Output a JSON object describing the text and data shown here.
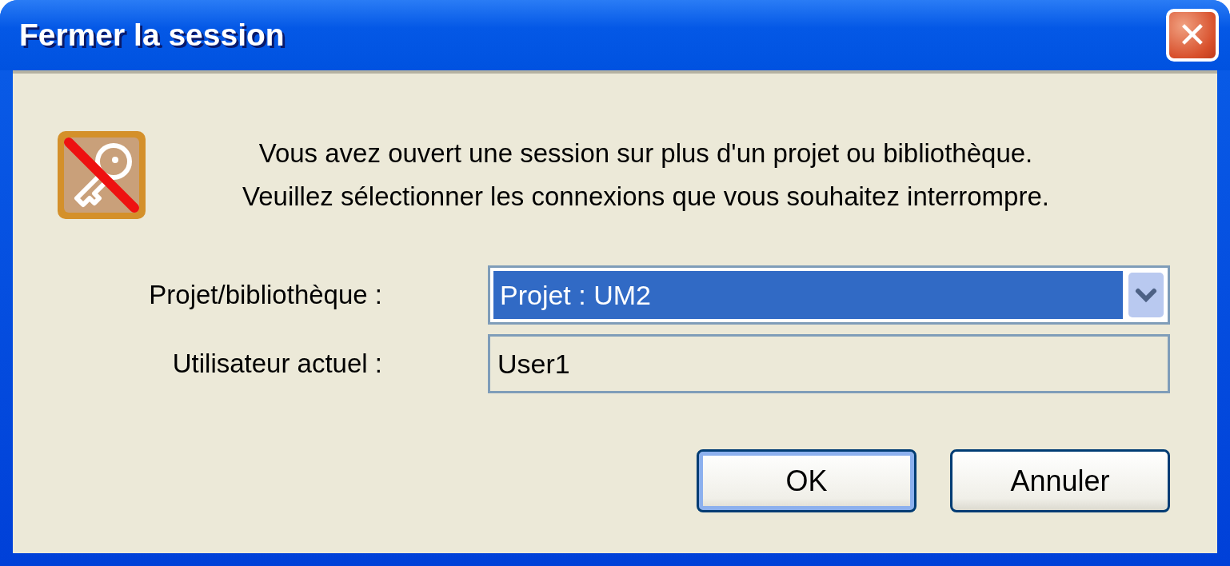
{
  "window": {
    "title": "Fermer la session",
    "close_label": "✕"
  },
  "message": [
    "Vous avez ouvert une session sur plus d'un projet ou bibliothèque.",
    "Veuillez sélectionner les connexions que vous souhaitez interrompre."
  ],
  "fields": [
    {
      "label": "Projet/bibliothèque :",
      "kind": "dropdown",
      "value": "Projet : UM2",
      "highlighted": true
    },
    {
      "label": "Utilisateur actuel :",
      "kind": "text",
      "value": "User1",
      "highlighted": false
    }
  ],
  "buttons": [
    {
      "label": "OK",
      "default": true
    },
    {
      "label": "Annuler",
      "default": false
    }
  ]
}
